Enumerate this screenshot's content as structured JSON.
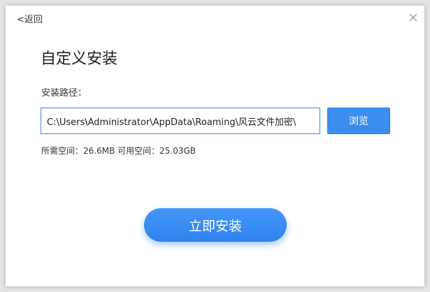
{
  "header": {
    "back_label": "<返回",
    "close_icon": "close-icon"
  },
  "main": {
    "title": "自定义安装",
    "path_label": "安装路径：",
    "path_value": "C:\\Users\\Administrator\\AppData\\Roaming\\风云文件加密\\",
    "browse_label": "浏览",
    "required_space": "所需空间：26.6MB",
    "available_space": "可用空间：25.03GB",
    "install_label": "立即安装"
  },
  "colors": {
    "accent": "#3b8ef0",
    "input_border": "#3a86ea",
    "background": "#ffffff"
  }
}
